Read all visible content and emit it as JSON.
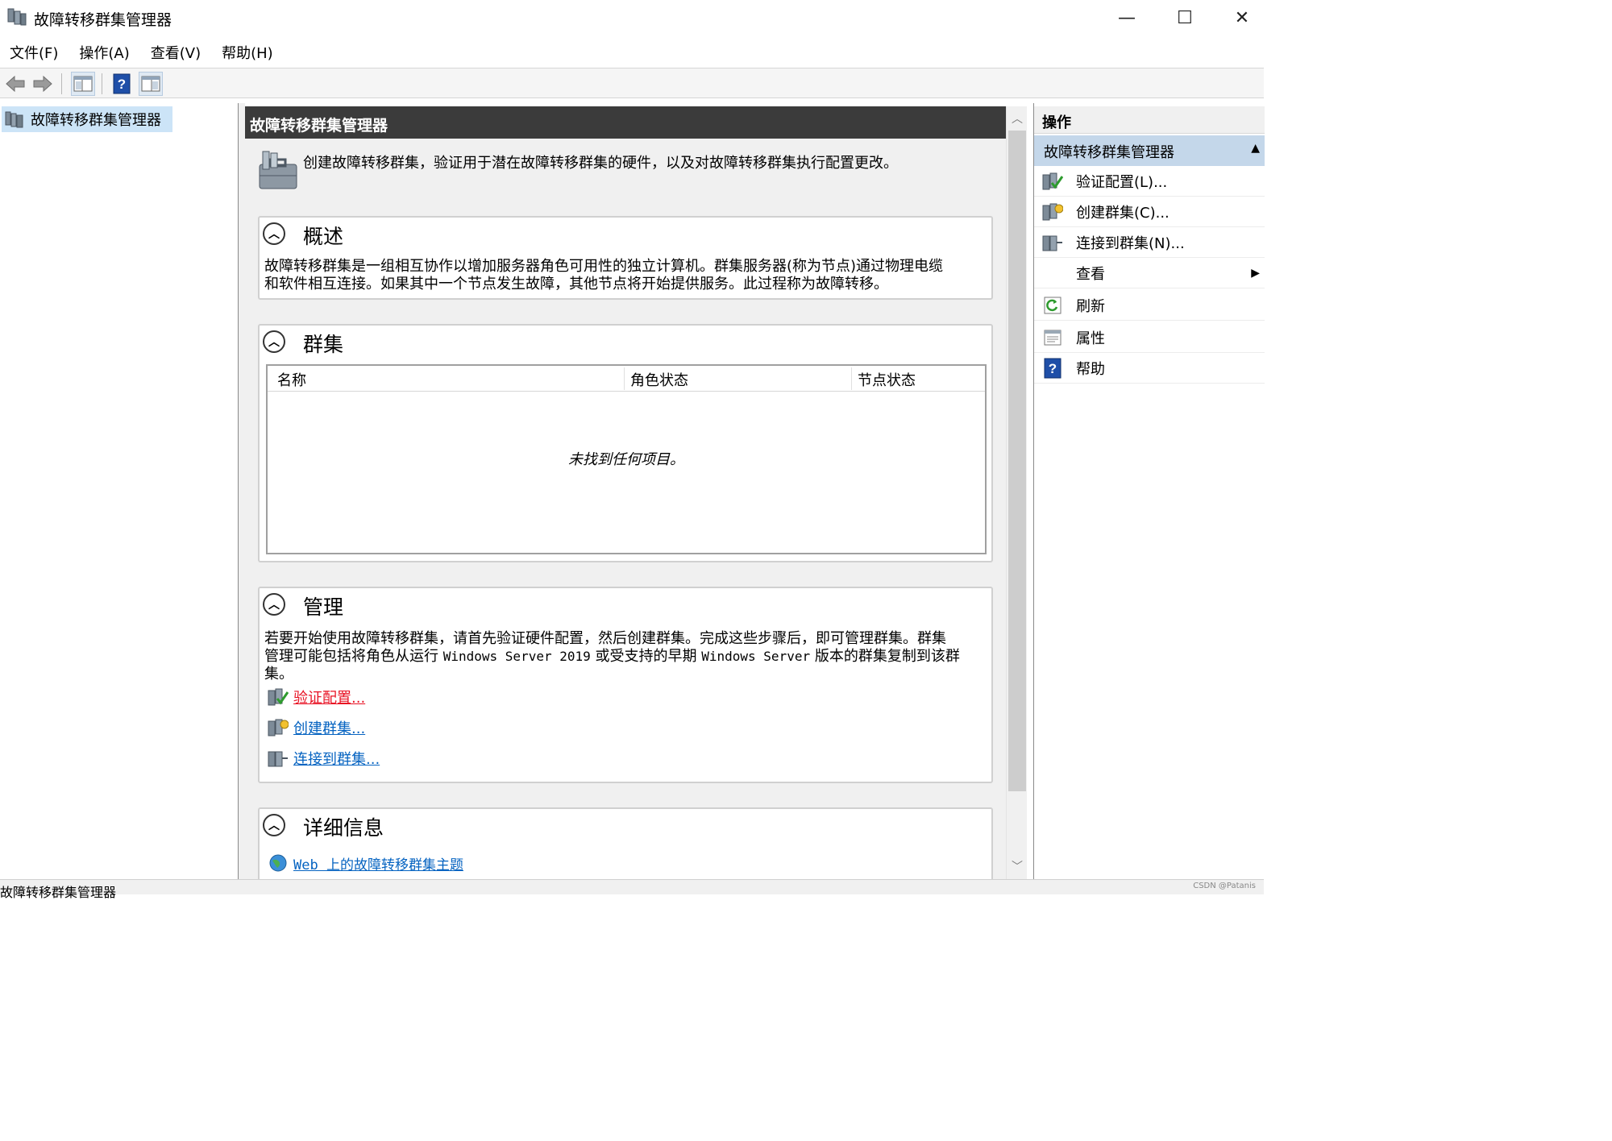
{
  "window": {
    "title": "故障转移群集管理器",
    "controls": {
      "minimize": "—",
      "maximize": "☐",
      "close": "✕"
    }
  },
  "menubar": {
    "items": [
      "文件(F)",
      "操作(A)",
      "查看(V)",
      "帮助(H)"
    ]
  },
  "toolbar": {
    "icons": [
      "back-arrow-icon",
      "forward-arrow-icon",
      "show-console-tree-icon",
      "help-icon",
      "show-action-pane-icon"
    ]
  },
  "tree": {
    "root_label": "故障转移群集管理器"
  },
  "center": {
    "header": "故障转移群集管理器",
    "intro": "创建故障转移群集，验证用于潜在故障转移群集的硬件，以及对故障转移群集执行配置更改。",
    "overview": {
      "title": "概述",
      "line1": "故障转移群集是一组相互协作以增加服务器角色可用性的独立计算机。群集服务器(称为节点)通过物理电缆",
      "line2": "和软件相互连接。如果其中一个节点发生故障，其他节点将开始提供服务。此过程称为故障转移。"
    },
    "clusters": {
      "title": "群集",
      "columns": [
        "名称",
        "角色状态",
        "节点状态"
      ],
      "empty_text": "未找到任何项目。"
    },
    "management": {
      "title": "管理",
      "text_line1": "若要开始使用故障转移群集，请首先验证硬件配置，然后创建群集。完成这些步骤后，即可管理群集。群集",
      "text_line2_a": "管理可能包括将角色从运行",
      "text_line2_b": "Windows Server 2019",
      "text_line2_c": "或受支持的早期",
      "text_line2_d": "Windows Server",
      "text_line2_e": "版本的群集复制到该群",
      "text_line3": "集。",
      "links": [
        "验证配置...",
        "创建群集...",
        "连接到群集..."
      ]
    },
    "details": {
      "title": "详细信息",
      "link": "Web 上的故障转移群集主题"
    }
  },
  "actions": {
    "header": "操作",
    "group": "故障转移群集管理器",
    "items": [
      {
        "label": "验证配置(L)...",
        "icon": "validate-config-icon"
      },
      {
        "label": "创建群集(C)...",
        "icon": "create-cluster-icon"
      },
      {
        "label": "连接到群集(N)...",
        "icon": "connect-cluster-icon"
      },
      {
        "label": "查看",
        "icon": "none"
      },
      {
        "label": "刷新",
        "icon": "refresh-icon"
      },
      {
        "label": "属性",
        "icon": "properties-icon"
      },
      {
        "label": "帮助",
        "icon": "help-icon"
      }
    ]
  },
  "statusbar": {
    "text": "故障转移群集管理器",
    "watermark": "CSDN @Patanis"
  },
  "colors": {
    "link": "#0563c1",
    "link_hover": "#e81123",
    "header_bg": "#3b3b3b",
    "action_group_bg": "#c4d7ea",
    "selection_bg": "#cce4f7"
  }
}
